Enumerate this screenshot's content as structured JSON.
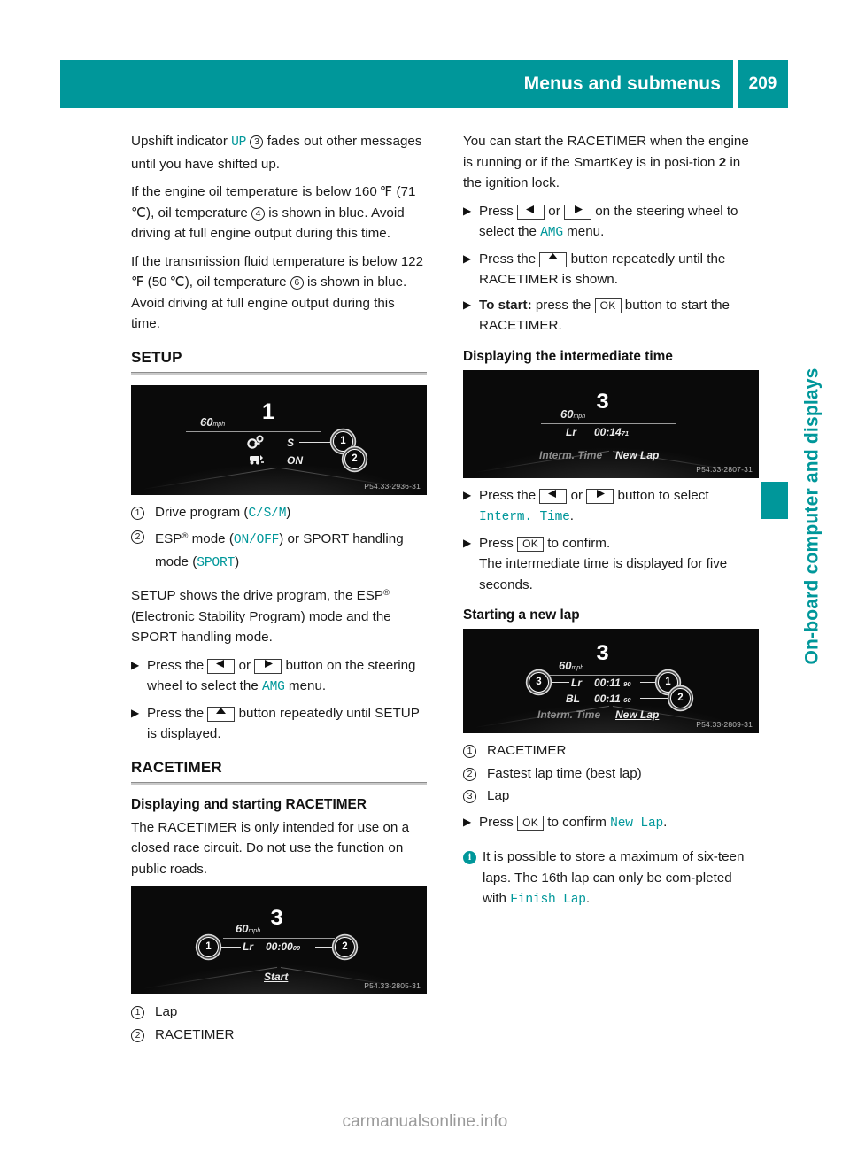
{
  "header": {
    "title": "Menus and submenus",
    "page_number": "209"
  },
  "side_tab": {
    "label": "On-board computer and displays"
  },
  "colors": {
    "accent_teal": "#00979a",
    "text": "#1b1b1b",
    "rule_gray": "#8d8d8d"
  },
  "left_column": {
    "para_upshift_pre": "Upshift indicator ",
    "para_upshift_token": "UP",
    "para_upshift_ref": "3",
    "para_upshift_post": " fades out other messages until you have shifted up.",
    "para_oil_a": "If the engine oil temperature is below 160 ℉ (71 ℃), oil temperature ",
    "para_oil_ref": "4",
    "para_oil_b": " is shown in blue. Avoid driving at full engine output during this time.",
    "para_trans_a": "If the transmission fluid temperature is below 122 ℉ (50 ℃), oil temperature ",
    "para_trans_ref": "6",
    "para_trans_b": " is shown in blue. Avoid driving at full engine output during this time.",
    "setup_heading": "SETUP",
    "setup_figure": {
      "speed": "60",
      "speed_unit": "mph",
      "gear": "1",
      "label_drive_program": "S",
      "label_esp": "ON",
      "callout_1": "1",
      "callout_2": "2",
      "image_id": "P54.33-2936-31"
    },
    "setup_legend": [
      {
        "num": "1",
        "pre": "Drive program (",
        "token": "C/S/M",
        "post": ")"
      },
      {
        "num": "2",
        "pre": "ESP",
        "sup": "®",
        "mid1": " mode (",
        "token1": "ON/OFF",
        "mid2": ") or SPORT handling mode (",
        "token2": "SPORT",
        "post": ")"
      }
    ],
    "setup_para_a": "SETUP shows the drive program, the ESP",
    "setup_para_sup": "®",
    "setup_para_b": " (Electronic Stability Program) mode and the SPORT handling mode.",
    "setup_step_1_a": "Press the ",
    "setup_step_1_or": " or ",
    "setup_step_1_b": " button on the steering wheel to select the ",
    "setup_step_1_token": "AMG",
    "setup_step_1_c": " menu.",
    "setup_step_2_a": "Press the ",
    "setup_step_2_b": " button repeatedly until SETUP is displayed.",
    "racetimer_heading": "RACETIMER",
    "racetimer_subhead": "Displaying and starting RACETIMER",
    "racetimer_para": "The RACETIMER is only intended for use on a closed race circuit. Do not use the function on public roads.",
    "racetimer_figure": {
      "speed": "60",
      "speed_unit": "mph",
      "gear": "3",
      "lap_label": "Lr",
      "time": "00:00",
      "time_small": "00",
      "menu_start": "Start",
      "callout_1": "1",
      "callout_2": "2",
      "image_id": "P54.33-2805-31"
    },
    "racetimer_legend": [
      {
        "num": "1",
        "text": "Lap"
      },
      {
        "num": "2",
        "text": "RACETIMER"
      }
    ]
  },
  "right_column": {
    "para_start_a": "You can start the RACETIMER when the engine is running or if the SmartKey is in posi-tion ",
    "para_start_bold": "2",
    "para_start_b": " in the ignition lock.",
    "step_press_a": "Press ",
    "step_press_or": " or ",
    "step_press_b": " on the steering wheel to select the ",
    "step_press_token": "AMG",
    "step_press_c": " menu.",
    "step_up_a": "Press the ",
    "step_up_b": " button repeatedly until the RACETIMER is shown.",
    "step_start_bold": "To start:",
    "step_start_a": " press the ",
    "step_start_key": "OK",
    "step_start_b": " button to start the RACETIMER.",
    "interm_subhead": "Displaying the intermediate time",
    "interm_figure": {
      "speed": "60",
      "speed_unit": "mph",
      "gear": "3",
      "lap_label": "Lr",
      "time": "00:14",
      "time_small": "71",
      "menu_interm": "Interm. Time",
      "menu_newlap": "New Lap",
      "image_id": "P54.33-2807-31"
    },
    "interm_step_1_a": "Press the ",
    "interm_step_1_or": " or ",
    "interm_step_1_b": " button to select ",
    "interm_step_1_token": "Interm. Time",
    "interm_step_1_c": ".",
    "interm_step_2_a": "Press ",
    "interm_step_2_key": "OK",
    "interm_step_2_b": " to confirm.",
    "interm_step_2_note": "The intermediate time is displayed for five seconds.",
    "newlap_subhead": "Starting a new lap",
    "newlap_figure": {
      "speed": "60",
      "speed_unit": "mph",
      "gear": "3",
      "lap_label": "Lr",
      "lap_time": "00:11",
      "lap_time_small": "90",
      "best_label": "BL",
      "best_time": "00:11",
      "best_time_small": "60",
      "menu_interm": "Interm. Time",
      "menu_newlap": "New Lap",
      "callout_1": "1",
      "callout_2": "2",
      "callout_3": "3",
      "image_id": "P54.33-2809-31"
    },
    "newlap_legend": [
      {
        "num": "1",
        "text": "RACETIMER"
      },
      {
        "num": "2",
        "text": "Fastest lap time (best lap)"
      },
      {
        "num": "3",
        "text": "Lap"
      }
    ],
    "newlap_step_a": "Press ",
    "newlap_step_key": "OK",
    "newlap_step_b": " to confirm ",
    "newlap_step_token": "New Lap",
    "newlap_step_c": ".",
    "note_a": "It is possible to store a maximum of six-teen laps. The 16th lap can only be com-pleted with ",
    "note_token": "Finish Lap",
    "note_b": "."
  },
  "footer": {
    "watermark": "carmanualsonline.info"
  }
}
